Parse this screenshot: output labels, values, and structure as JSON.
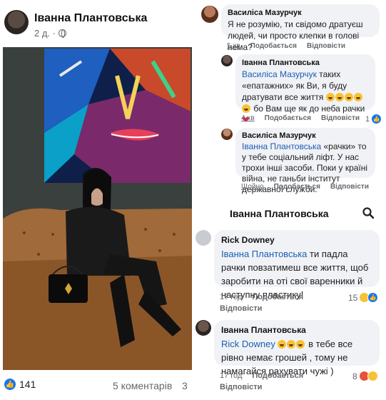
{
  "post": {
    "author": "Іванна Плантовська",
    "time": "2 д. ·",
    "reaction_count": "141",
    "comment_count": "5 коментарів",
    "share_count": "3"
  },
  "comments": [
    {
      "name": "Василіса Мазурчук",
      "text": "Я не розумію, ти свідомо дратуєш людей, чи просто клепки в голові нема?",
      "time": "5 хв",
      "like": "Подобається",
      "reply": "Відповісти"
    },
    {
      "name": "Іванна Плантовська",
      "mention": "Василіса Мазурчук",
      "text_a": " таких «епатажних» як Ви, я буду дратувати все життя ",
      "text_b": " бо Вам ще як до неба рачки ",
      "time": "4 хв",
      "like": "Подобається",
      "reply": "Відповісти",
      "reaction_count": "1"
    },
    {
      "name": "Василіса Мазурчук",
      "mention": "Іванна Плантовська",
      "text": " «рачки» то у тебе соціальний ліфт. У нас трохи інші засоби. Поки у країні війна, не ганьби інститут державної служби.",
      "time": "Щойно",
      "like": "Подобається",
      "reply": "Відповісти"
    }
  ],
  "thread": {
    "title": "Іванна Плантовська",
    "comments": [
      {
        "name": "Rick Downey",
        "mention": "Іванна Плантовська",
        "text": " ти падла рачки повзатимеш все життя, щоб заробити на оті свої варенники й наступну пластику!",
        "time": "17 год",
        "like": "Подобається",
        "reply": "Відповісти",
        "reaction_count": "15"
      },
      {
        "name": "Іванна Плантовська",
        "mention": "Rick Downey",
        "text": " в тебе все рівно немає грошей , тому не намагайся рахувати чужі )",
        "time": "17 год",
        "like": "Подобається",
        "reply": "Відповісти",
        "reaction_count": "8"
      }
    ]
  },
  "colors": {
    "mention": "#1a5fb4",
    "like": "#1877f2",
    "bubble": "#f0f2f5"
  }
}
